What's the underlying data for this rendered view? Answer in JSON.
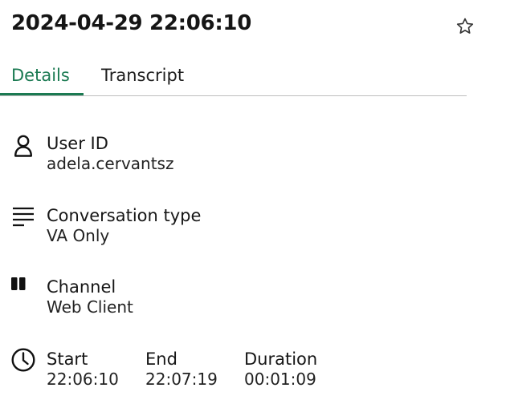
{
  "header": {
    "title": "2024-04-29 22:06:10",
    "favorite_icon": "star-outline-icon"
  },
  "tabs": [
    {
      "label": "Details",
      "active": true
    },
    {
      "label": "Transcript",
      "active": false
    }
  ],
  "accent_color": "#1b7a52",
  "details": {
    "user": {
      "icon": "user-icon",
      "label": "User ID",
      "value": "adela.cervantsz"
    },
    "conversation_type": {
      "icon": "lines-icon",
      "label": "Conversation type",
      "value": "VA Only"
    },
    "channel": {
      "icon": "channel-icon",
      "label": "Channel",
      "value": "Web Client"
    },
    "timing": {
      "icon": "clock-icon",
      "start_label": "Start",
      "start_value": "22:06:10",
      "end_label": "End",
      "end_value": "22:07:19",
      "duration_label": "Duration",
      "duration_value": "00:01:09"
    }
  }
}
